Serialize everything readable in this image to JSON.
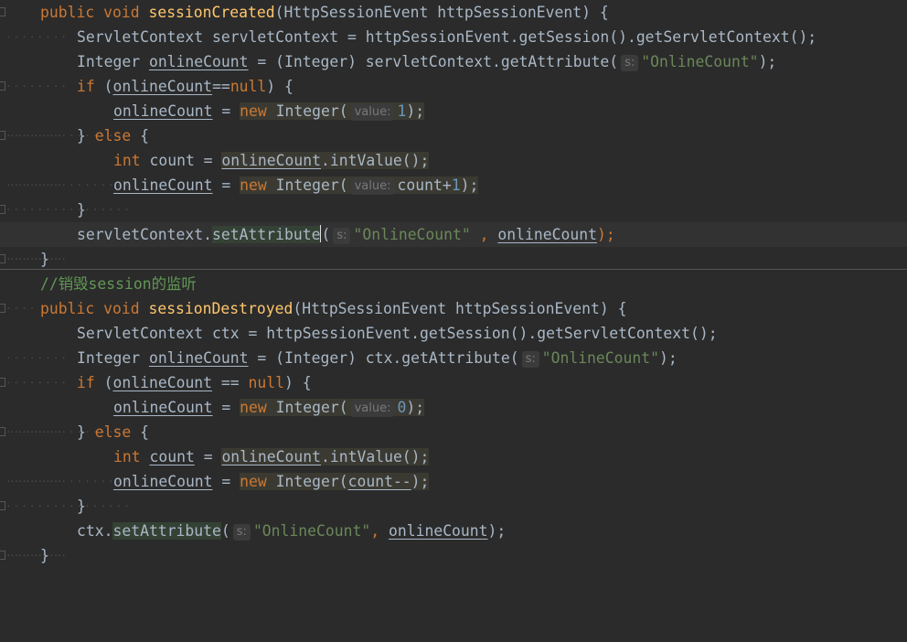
{
  "code": {
    "l1": {
      "kw1": "public",
      "kw2": "void",
      "fn": "sessionCreated",
      "rest": "(HttpSessionEvent httpSessionEvent) {"
    },
    "l2": {
      "text": "ServletContext servletContext = httpSessionEvent.getSession().getServletContext();"
    },
    "l3": {
      "type": "Integer ",
      "var": "onlineCount",
      "mid": " = (Integer) servletContext.getAttribute(",
      "hint": "s:",
      "str": "\"OnlineCount\"",
      "end": ");"
    },
    "l4": {
      "kw": "if",
      "p1": " (",
      "var": "onlineCount",
      "op": "==",
      "kwnull": "null",
      "end": ") {"
    },
    "l5": {
      "var": "onlineCount",
      "eq": " = ",
      "kw": "new",
      "cls": " Integer(",
      "hint": "value:",
      "num": "1",
      "end": ");"
    },
    "l6": {
      "b": "} ",
      "kw": "else",
      "end": " {"
    },
    "l7": {
      "kw": "int",
      "mid": " count = ",
      "var": "onlineCount",
      "end": ".intValue();"
    },
    "l8": {
      "var": "onlineCount",
      "eq": " = ",
      "kw": "new",
      "cls": " Integer(",
      "hint": "value:",
      "expr": "count+",
      "num": "1",
      "end": ");"
    },
    "l9": {
      "text": "}"
    },
    "l10": {
      "obj": "servletContext.",
      "fn": "setAttribute",
      "open": "(",
      "hint": "s:",
      "str": "\"OnlineCount\"",
      "comma": " , ",
      "var": "onlineCount",
      "end": ");"
    },
    "l11": {
      "text": "}"
    },
    "l12": {
      "comment": "//销毁session的监听"
    },
    "l13": {
      "kw1": "public",
      "kw2": "void",
      "fn": "sessionDestroyed",
      "rest": "(HttpSessionEvent httpSessionEvent) {"
    },
    "l14": {
      "text": "ServletContext ctx = httpSessionEvent.getSession().getServletContext();"
    },
    "l15": {
      "type": "Integer ",
      "var": "onlineCount",
      "mid": " = (Integer) ctx.getAttribute(",
      "hint": "s:",
      "str": "\"OnlineCount\"",
      "end": ");"
    },
    "l16": {
      "kw": "if",
      "p1": " (",
      "var": "onlineCount",
      "op": " == ",
      "kwnull": "null",
      "end": ") {"
    },
    "l17": {
      "var": "onlineCount",
      "eq": " = ",
      "kw": "new",
      "cls": " Integer(",
      "hint": "value:",
      "num": "0",
      "end": ");"
    },
    "l18": {
      "b": "} ",
      "kw": "else",
      "end": " {"
    },
    "l19": {
      "kw": "int",
      "sp": " ",
      "var2": "count",
      "eq": " = ",
      "var": "onlineCount",
      "end": ".intValue();"
    },
    "l20": {
      "var": "onlineCount",
      "eq": " = ",
      "kw": "new",
      "cls": " Integer(",
      "var2": "count--",
      "end": ");"
    },
    "l21": {
      "text": "}"
    },
    "l22": {
      "obj": "ctx.",
      "fn": "setAttribute",
      "open": "(",
      "hint": "s:",
      "str": "\"OnlineCount\"",
      "comma": ", ",
      "var": "onlineCount",
      "end": ");"
    },
    "l23": {
      "text": "}"
    }
  },
  "colors": {
    "background": "#2b2b2b",
    "keyword": "#cc7832",
    "method": "#ffc66d",
    "string": "#6a8759",
    "number": "#6897bb",
    "comment": "#629755",
    "text": "#a9b7c6"
  }
}
